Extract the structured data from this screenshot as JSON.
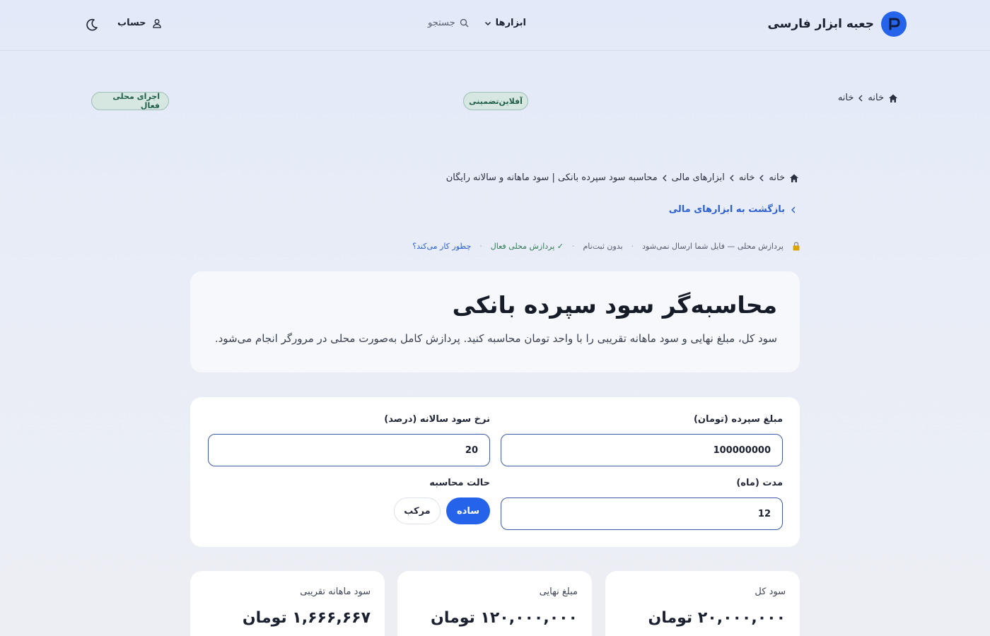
{
  "header": {
    "brand_name": "جعبه ابزار فارسی",
    "tools_label": "ابزارها",
    "search_label": "جستجو",
    "account_label": "حساب"
  },
  "top_breadcrumb": {
    "items": [
      "خانه",
      "خانه"
    ]
  },
  "badges": {
    "offline": "آفلاین‌تضمینی",
    "local": "اجرای محلی فعال"
  },
  "breadcrumb": {
    "items": [
      "خانه",
      "خانه",
      "ابزارهای مالی",
      "محاسبه سود سپرده بانکی | سود ماهانه و سالانه رایگان"
    ]
  },
  "back_link": "بازگشت به ابزارهای مالی",
  "trust": {
    "local_processing": "پردازش محلی — فایل شما ارسال نمی‌شود",
    "no_signup": "بدون ثبت‌نام",
    "local_active": "✓ پردازش محلی فعال",
    "how_it_works": "چطور کار می‌کند؟"
  },
  "hero": {
    "title": "محاسبه‌گر سود سپرده بانکی",
    "description": "سود کل، مبلغ نهایی و سود ماهانه تقریبی را با واحد تومان محاسبه کنید. پردازش کامل به‌صورت محلی در مرورگر انجام می‌شود."
  },
  "form": {
    "deposit_label": "مبلغ سپرده (تومان)",
    "deposit_value": "100000000",
    "rate_label": "نرخ سود سالانه (درصد)",
    "rate_value": "20",
    "duration_label": "مدت (ماه)",
    "duration_value": "12",
    "mode_label": "حالت محاسبه",
    "mode_simple": "ساده",
    "mode_compound": "مرکب",
    "mode_selected": "ساده"
  },
  "results": [
    {
      "label": "سود کل",
      "value": "۲۰,۰۰۰,۰۰۰ تومان"
    },
    {
      "label": "مبلغ نهایی",
      "value": "۱۲۰,۰۰۰,۰۰۰ تومان"
    },
    {
      "label": "سود ماهانه تقریبی",
      "value": "۱,۶۶۶,۶۶۷ تومان"
    }
  ],
  "colors": {
    "accent": "#2563eb",
    "badge_bg": "#d6e6e1",
    "link": "#2c5fd1"
  },
  "icons": [
    "logo-icon",
    "chevron-down-icon",
    "search-icon",
    "user-icon",
    "moon-icon",
    "home-icon",
    "chevron-left-icon",
    "lock-icon"
  ]
}
